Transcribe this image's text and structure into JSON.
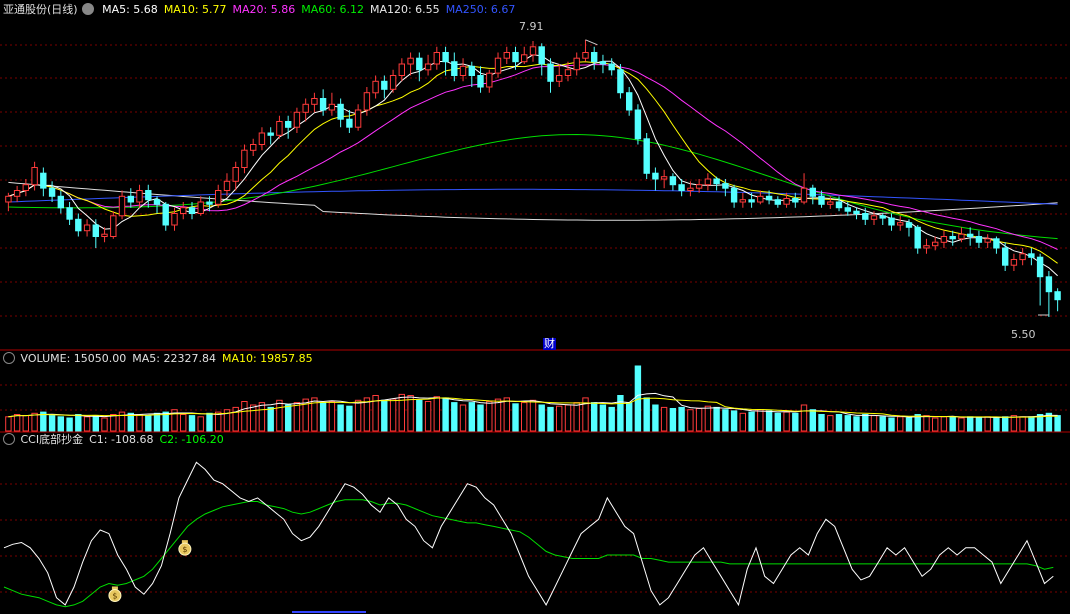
{
  "stock_title": "亚通股份(日线)",
  "price_legend": [
    {
      "key": "MA5",
      "label": "MA5: 5.68",
      "color": "#ffffff"
    },
    {
      "key": "MA10",
      "label": "MA10: 5.77",
      "color": "#ffff00"
    },
    {
      "key": "MA20",
      "label": "MA20: 5.86",
      "color": "#ff33ff"
    },
    {
      "key": "MA60",
      "label": "MA60: 6.12",
      "color": "#00ee00"
    },
    {
      "key": "MA120",
      "label": "MA120: 6.55",
      "color": "#e8e8e8"
    },
    {
      "key": "MA250",
      "label": "MA250: 6.67",
      "color": "#3355ff"
    }
  ],
  "high_marker": "7.91",
  "low_marker": "5.50",
  "finance_marker": "财",
  "volume_legend": [
    {
      "label": "VOLUME: 15050.00",
      "color": "#e0e0e0"
    },
    {
      "label": "MA5: 22327.84",
      "color": "#e0e0e0"
    },
    {
      "label": "MA10: 19857.85",
      "color": "#ffff00"
    }
  ],
  "cci_legend": [
    {
      "label": "CCI底部抄金",
      "color": "#e0e0e0"
    },
    {
      "label": "C1: -108.68",
      "color": "#e0e0e0"
    },
    {
      "label": "C2: -106.20",
      "color": "#00ff00"
    }
  ],
  "signal_icon": "money-bag-icon",
  "chart_data": {
    "type": "candlestick",
    "title": "亚通股份(日线)",
    "price_range": [
      5.3,
      8.1
    ],
    "candles": [
      [
        6.5,
        6.55,
        6.42,
        6.58
      ],
      [
        6.55,
        6.6,
        6.5,
        6.64
      ],
      [
        6.6,
        6.65,
        6.55,
        6.7
      ],
      [
        6.65,
        6.8,
        6.6,
        6.85
      ],
      [
        6.75,
        6.62,
        6.55,
        6.8
      ],
      [
        6.62,
        6.55,
        6.5,
        6.68
      ],
      [
        6.55,
        6.45,
        6.4,
        6.6
      ],
      [
        6.45,
        6.35,
        6.3,
        6.5
      ],
      [
        6.35,
        6.25,
        6.2,
        6.4
      ],
      [
        6.25,
        6.3,
        6.2,
        6.35
      ],
      [
        6.3,
        6.2,
        6.1,
        6.35
      ],
      [
        6.2,
        6.22,
        6.15,
        6.28
      ],
      [
        6.2,
        6.38,
        6.18,
        6.42
      ],
      [
        6.38,
        6.55,
        6.35,
        6.6
      ],
      [
        6.55,
        6.5,
        6.45,
        6.62
      ],
      [
        6.5,
        6.6,
        6.45,
        6.65
      ],
      [
        6.6,
        6.52,
        6.45,
        6.65
      ],
      [
        6.52,
        6.48,
        6.4,
        6.55
      ],
      [
        6.48,
        6.3,
        6.25,
        6.5
      ],
      [
        6.3,
        6.4,
        6.25,
        6.45
      ],
      [
        6.4,
        6.45,
        6.35,
        6.5
      ],
      [
        6.45,
        6.4,
        6.35,
        6.5
      ],
      [
        6.4,
        6.5,
        6.38,
        6.55
      ],
      [
        6.5,
        6.48,
        6.42,
        6.55
      ],
      [
        6.48,
        6.6,
        6.45,
        6.65
      ],
      [
        6.6,
        6.68,
        6.55,
        6.75
      ],
      [
        6.68,
        6.8,
        6.6,
        6.85
      ],
      [
        6.8,
        6.95,
        6.75,
        7.0
      ],
      [
        6.95,
        7.0,
        6.9,
        7.05
      ],
      [
        7.0,
        7.1,
        6.95,
        7.15
      ],
      [
        7.1,
        7.08,
        7.0,
        7.15
      ],
      [
        7.08,
        7.2,
        7.05,
        7.25
      ],
      [
        7.2,
        7.15,
        7.05,
        7.25
      ],
      [
        7.15,
        7.28,
        7.1,
        7.32
      ],
      [
        7.28,
        7.35,
        7.2,
        7.4
      ],
      [
        7.35,
        7.4,
        7.28,
        7.45
      ],
      [
        7.4,
        7.3,
        7.25,
        7.48
      ],
      [
        7.3,
        7.35,
        7.25,
        7.45
      ],
      [
        7.35,
        7.22,
        7.15,
        7.4
      ],
      [
        7.22,
        7.15,
        7.1,
        7.3
      ],
      [
        7.15,
        7.3,
        7.12,
        7.35
      ],
      [
        7.3,
        7.45,
        7.25,
        7.5
      ],
      [
        7.45,
        7.55,
        7.4,
        7.6
      ],
      [
        7.55,
        7.48,
        7.4,
        7.6
      ],
      [
        7.48,
        7.6,
        7.45,
        7.65
      ],
      [
        7.6,
        7.7,
        7.55,
        7.75
      ],
      [
        7.7,
        7.75,
        7.6,
        7.8
      ],
      [
        7.75,
        7.65,
        7.55,
        7.8
      ],
      [
        7.65,
        7.7,
        7.6,
        7.78
      ],
      [
        7.7,
        7.8,
        7.65,
        7.85
      ],
      [
        7.8,
        7.72,
        7.6,
        7.85
      ],
      [
        7.72,
        7.6,
        7.55,
        7.8
      ],
      [
        7.6,
        7.68,
        7.55,
        7.75
      ],
      [
        7.68,
        7.6,
        7.5,
        7.72
      ],
      [
        7.6,
        7.5,
        7.45,
        7.68
      ],
      [
        7.5,
        7.62,
        7.45,
        7.65
      ],
      [
        7.62,
        7.75,
        7.58,
        7.8
      ],
      [
        7.75,
        7.8,
        7.7,
        7.85
      ],
      [
        7.8,
        7.72,
        7.65,
        7.85
      ],
      [
        7.72,
        7.78,
        7.7,
        7.85
      ],
      [
        7.78,
        7.85,
        7.72,
        7.9
      ],
      [
        7.85,
        7.7,
        7.6,
        7.88
      ],
      [
        7.7,
        7.55,
        7.45,
        7.75
      ],
      [
        7.55,
        7.6,
        7.5,
        7.7
      ],
      [
        7.6,
        7.65,
        7.55,
        7.72
      ],
      [
        7.65,
        7.75,
        7.6,
        7.8
      ],
      [
        7.75,
        7.8,
        7.72,
        7.91
      ],
      [
        7.8,
        7.72,
        7.65,
        7.85
      ],
      [
        7.72,
        7.7,
        7.62,
        7.78
      ],
      [
        7.7,
        7.65,
        7.6,
        7.75
      ],
      [
        7.65,
        7.45,
        7.4,
        7.7
      ],
      [
        7.45,
        7.3,
        7.25,
        7.5
      ],
      [
        7.3,
        7.05,
        7.0,
        7.35
      ],
      [
        7.05,
        6.75,
        6.7,
        7.1
      ],
      [
        6.75,
        6.7,
        6.6,
        6.8
      ],
      [
        6.7,
        6.72,
        6.62,
        6.78
      ],
      [
        6.72,
        6.65,
        6.6,
        6.75
      ],
      [
        6.65,
        6.6,
        6.55,
        6.7
      ],
      [
        6.6,
        6.62,
        6.55,
        6.68
      ],
      [
        6.62,
        6.65,
        6.58,
        6.7
      ],
      [
        6.65,
        6.7,
        6.6,
        6.75
      ],
      [
        6.7,
        6.66,
        6.6,
        6.72
      ],
      [
        6.66,
        6.62,
        6.55,
        6.7
      ],
      [
        6.62,
        6.5,
        6.45,
        6.65
      ],
      [
        6.5,
        6.52,
        6.45,
        6.58
      ],
      [
        6.52,
        6.5,
        6.45,
        6.58
      ],
      [
        6.5,
        6.55,
        6.48,
        6.6
      ],
      [
        6.55,
        6.52,
        6.48,
        6.6
      ],
      [
        6.52,
        6.48,
        6.45,
        6.55
      ],
      [
        6.48,
        6.53,
        6.45,
        6.58
      ],
      [
        6.53,
        6.5,
        6.45,
        6.58
      ],
      [
        6.5,
        6.62,
        6.48,
        6.75
      ],
      [
        6.62,
        6.55,
        6.48,
        6.65
      ],
      [
        6.55,
        6.48,
        6.45,
        6.6
      ],
      [
        6.48,
        6.5,
        6.44,
        6.55
      ],
      [
        6.5,
        6.45,
        6.42,
        6.55
      ],
      [
        6.45,
        6.42,
        6.38,
        6.5
      ],
      [
        6.42,
        6.4,
        6.35,
        6.45
      ],
      [
        6.4,
        6.35,
        6.3,
        6.45
      ],
      [
        6.35,
        6.38,
        6.3,
        6.42
      ],
      [
        6.38,
        6.36,
        6.3,
        6.4
      ],
      [
        6.36,
        6.3,
        6.25,
        6.4
      ],
      [
        6.3,
        6.32,
        6.25,
        6.38
      ],
      [
        6.32,
        6.28,
        6.2,
        6.35
      ],
      [
        6.28,
        6.1,
        6.05,
        6.3
      ],
      [
        6.1,
        6.12,
        6.05,
        6.18
      ],
      [
        6.12,
        6.15,
        6.08,
        6.2
      ],
      [
        6.15,
        6.2,
        6.1,
        6.25
      ],
      [
        6.2,
        6.18,
        6.12,
        6.25
      ],
      [
        6.18,
        6.22,
        6.15,
        6.28
      ],
      [
        6.22,
        6.2,
        6.12,
        6.28
      ],
      [
        6.2,
        6.15,
        6.1,
        6.25
      ],
      [
        6.15,
        6.18,
        6.1,
        6.22
      ],
      [
        6.18,
        6.1,
        6.05,
        6.2
      ],
      [
        6.1,
        5.95,
        5.9,
        6.15
      ],
      [
        5.95,
        6.0,
        5.9,
        6.05
      ],
      [
        6.0,
        6.05,
        5.95,
        6.1
      ],
      [
        6.05,
        6.02,
        5.95,
        6.1
      ],
      [
        6.02,
        5.85,
        5.6,
        6.05
      ],
      [
        5.85,
        5.72,
        5.5,
        5.9
      ],
      [
        5.72,
        5.65,
        5.55,
        5.75
      ]
    ],
    "ma_ranges": {
      "MA120": [
        6.3,
        6.7
      ],
      "MA250": [
        6.45,
        6.55
      ]
    },
    "volume": [
      12,
      14,
      13,
      15,
      16,
      13,
      12,
      11,
      14,
      12,
      13,
      11,
      14,
      16,
      15,
      14,
      13,
      15,
      16,
      18,
      14,
      13,
      12,
      15,
      16,
      18,
      20,
      25,
      22,
      24,
      20,
      26,
      22,
      24,
      27,
      28,
      24,
      25,
      22,
      21,
      26,
      28,
      30,
      26,
      27,
      31,
      30,
      26,
      25,
      29,
      28,
      24,
      22,
      24,
      22,
      25,
      27,
      28,
      23,
      24,
      26,
      22,
      20,
      21,
      22,
      24,
      28,
      24,
      22,
      20,
      30,
      24,
      55,
      28,
      22,
      20,
      19,
      20,
      18,
      19,
      21,
      20,
      18,
      17,
      15,
      16,
      18,
      17,
      15,
      16,
      15,
      22,
      18,
      14,
      13,
      14,
      13,
      12,
      14,
      13,
      12,
      11,
      12,
      11,
      14,
      13,
      11,
      12,
      12,
      11,
      12,
      11,
      12,
      11,
      12,
      13,
      12,
      12,
      14,
      15,
      13
    ],
    "cci": {
      "C1": [
        -40,
        -30,
        -25,
        -40,
        -70,
        -110,
        -180,
        -200,
        -150,
        -80,
        -20,
        10,
        0,
        -60,
        -100,
        -150,
        -170,
        -140,
        -90,
        0,
        100,
        150,
        200,
        180,
        150,
        140,
        120,
        100,
        90,
        100,
        80,
        60,
        40,
        0,
        -20,
        -10,
        20,
        60,
        100,
        140,
        130,
        110,
        80,
        60,
        100,
        80,
        40,
        20,
        -20,
        -40,
        20,
        60,
        100,
        140,
        130,
        100,
        80,
        40,
        0,
        -60,
        -120,
        -160,
        -200,
        -150,
        -100,
        -50,
        0,
        20,
        40,
        100,
        60,
        20,
        0,
        -80,
        -160,
        -200,
        -180,
        -140,
        -100,
        -60,
        -40,
        -80,
        -120,
        -160,
        -200,
        -100,
        -40,
        -120,
        -140,
        -100,
        -60,
        -40,
        -60,
        0,
        40,
        20,
        -40,
        -100,
        -130,
        -120,
        -80,
        -40,
        -60,
        -40,
        -80,
        -120,
        -100,
        -60,
        -40,
        -60,
        -40,
        -40,
        -60,
        -80,
        -140,
        -100,
        -60,
        -20,
        -80,
        -140,
        -120
      ],
      "C2": [
        -150,
        -160,
        -170,
        -175,
        -180,
        -190,
        -200,
        -205,
        -200,
        -190,
        -170,
        -150,
        -140,
        -145,
        -140,
        -130,
        -120,
        -100,
        -70,
        -40,
        -10,
        20,
        40,
        55,
        65,
        75,
        80,
        85,
        90,
        90,
        80,
        75,
        70,
        60,
        55,
        60,
        70,
        80,
        90,
        95,
        95,
        95,
        90,
        80,
        85,
        85,
        80,
        70,
        60,
        50,
        45,
        40,
        35,
        30,
        30,
        25,
        20,
        15,
        10,
        5,
        -10,
        -30,
        -50,
        -60,
        -65,
        -70,
        -70,
        -70,
        -70,
        -60,
        -60,
        -60,
        -60,
        -70,
        -70,
        -75,
        -80,
        -80,
        -80,
        -80,
        -80,
        -80,
        -80,
        -85,
        -85,
        -85,
        -85,
        -85,
        -85,
        -85,
        -85,
        -85,
        -85,
        -85,
        -85,
        -85,
        -85,
        -85,
        -85,
        -85,
        -85,
        -85,
        -85,
        -85,
        -85,
        -85,
        -85,
        -85,
        -85,
        -85,
        -85,
        -85,
        -85,
        -85,
        -85,
        -85,
        -85,
        -85,
        -90,
        -100,
        -95
      ],
      "range": [
        -220,
        240
      ]
    },
    "signals": [
      12,
      20
    ]
  }
}
